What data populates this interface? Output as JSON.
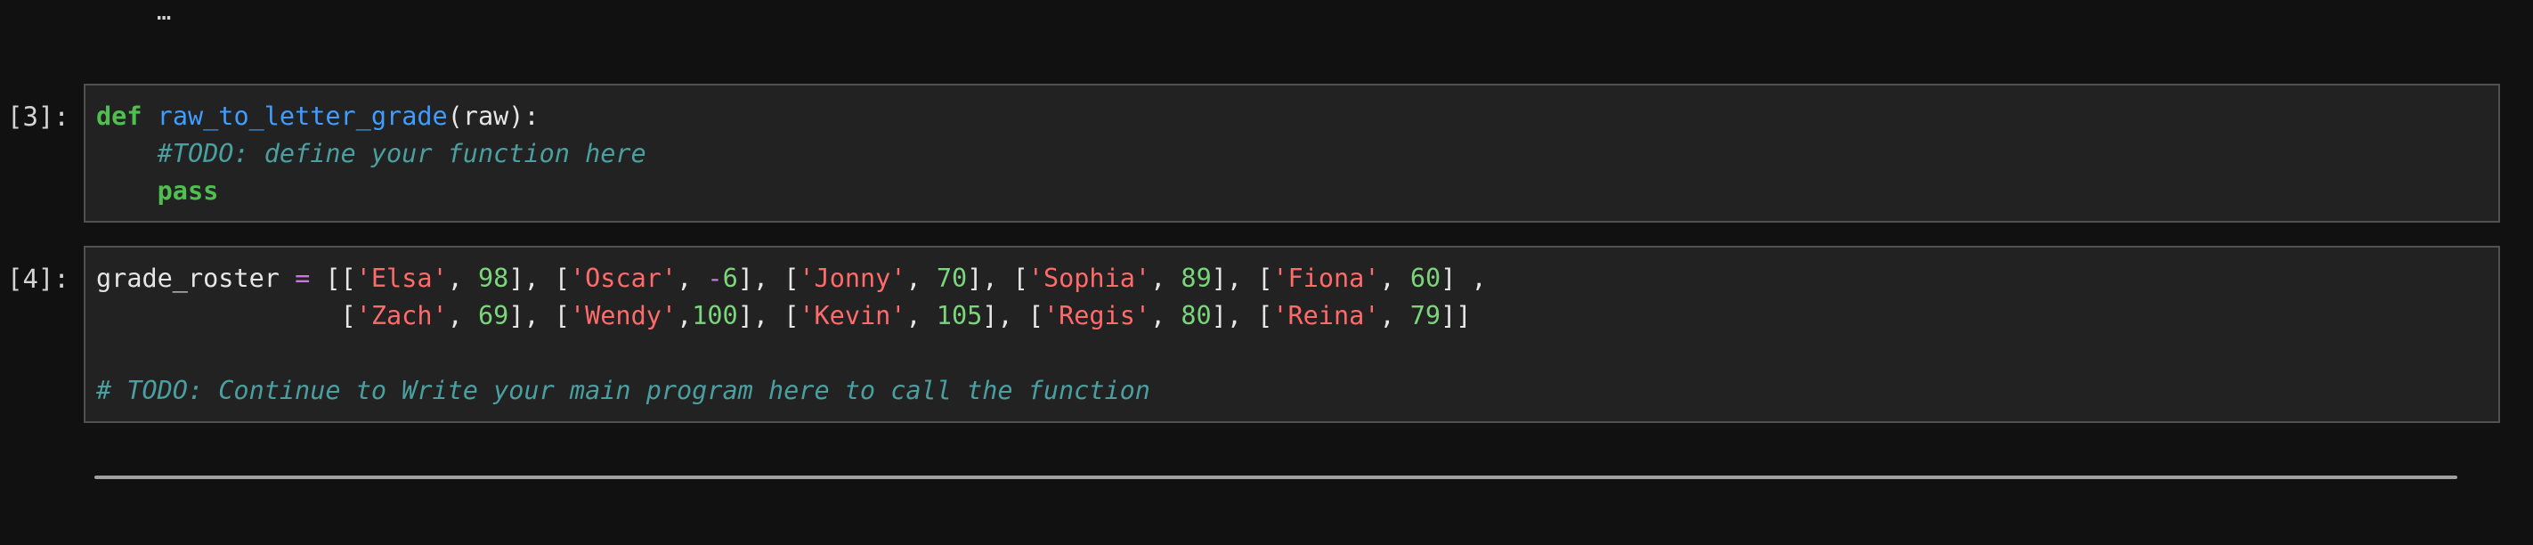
{
  "truncated_output": "…",
  "cells": [
    {
      "prompt": "[3]:",
      "lines": [
        [
          {
            "t": "def",
            "k": "kw"
          },
          {
            "t": " ",
            "k": "pl"
          },
          {
            "t": "raw_to_letter_grade",
            "k": "fn"
          },
          {
            "t": "(raw):",
            "k": "pl"
          }
        ],
        [
          {
            "t": "    ",
            "k": "pl"
          },
          {
            "t": "#TODO: define your function here",
            "k": "cm"
          }
        ],
        [
          {
            "t": "    ",
            "k": "pl"
          },
          {
            "t": "pass",
            "k": "kw"
          }
        ]
      ]
    },
    {
      "prompt": "[4]:",
      "lines": [
        [
          {
            "t": "grade_roster ",
            "k": "pl"
          },
          {
            "t": "=",
            "k": "op"
          },
          {
            "t": " [[",
            "k": "pl"
          },
          {
            "t": "'Elsa'",
            "k": "str"
          },
          {
            "t": ", ",
            "k": "pl"
          },
          {
            "t": "98",
            "k": "num"
          },
          {
            "t": "], [",
            "k": "pl"
          },
          {
            "t": "'Oscar'",
            "k": "str"
          },
          {
            "t": ", ",
            "k": "pl"
          },
          {
            "t": "-",
            "k": "op"
          },
          {
            "t": "6",
            "k": "num"
          },
          {
            "t": "], [",
            "k": "pl"
          },
          {
            "t": "'Jonny'",
            "k": "str"
          },
          {
            "t": ", ",
            "k": "pl"
          },
          {
            "t": "70",
            "k": "num"
          },
          {
            "t": "], [",
            "k": "pl"
          },
          {
            "t": "'Sophia'",
            "k": "str"
          },
          {
            "t": ", ",
            "k": "pl"
          },
          {
            "t": "89",
            "k": "num"
          },
          {
            "t": "], [",
            "k": "pl"
          },
          {
            "t": "'Fiona'",
            "k": "str"
          },
          {
            "t": ", ",
            "k": "pl"
          },
          {
            "t": "60",
            "k": "num"
          },
          {
            "t": "] ,",
            "k": "pl"
          }
        ],
        [
          {
            "t": "                [",
            "k": "pl"
          },
          {
            "t": "'Zach'",
            "k": "str"
          },
          {
            "t": ", ",
            "k": "pl"
          },
          {
            "t": "69",
            "k": "num"
          },
          {
            "t": "], [",
            "k": "pl"
          },
          {
            "t": "'Wendy'",
            "k": "str"
          },
          {
            "t": ",",
            "k": "pl"
          },
          {
            "t": "100",
            "k": "num"
          },
          {
            "t": "], [",
            "k": "pl"
          },
          {
            "t": "'Kevin'",
            "k": "str"
          },
          {
            "t": ", ",
            "k": "pl"
          },
          {
            "t": "105",
            "k": "num"
          },
          {
            "t": "], [",
            "k": "pl"
          },
          {
            "t": "'Regis'",
            "k": "str"
          },
          {
            "t": ", ",
            "k": "pl"
          },
          {
            "t": "80",
            "k": "num"
          },
          {
            "t": "], [",
            "k": "pl"
          },
          {
            "t": "'Reina'",
            "k": "str"
          },
          {
            "t": ", ",
            "k": "pl"
          },
          {
            "t": "79",
            "k": "num"
          },
          {
            "t": "]]",
            "k": "pl"
          }
        ],
        [],
        [
          {
            "t": "# TODO: Continue to Write your main program here to call the function",
            "k": "cm"
          }
        ]
      ]
    }
  ],
  "colors": {
    "background": "#111111",
    "cell_background": "#222222",
    "cell_border": "#515151",
    "keyword": "#4fbf4f",
    "function": "#3f9dff",
    "string": "#ff6b6b",
    "number": "#7bd67b",
    "operator": "#c678dd",
    "comment": "#4a9fa0",
    "plain": "#e6e6e6"
  }
}
